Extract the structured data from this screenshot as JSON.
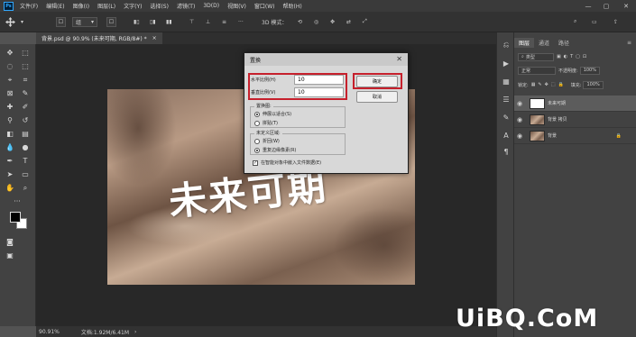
{
  "menu": {
    "logo": "Ps",
    "items": [
      "文件(F)",
      "编辑(E)",
      "图像(I)",
      "图层(L)",
      "文字(Y)",
      "选择(S)",
      "滤镜(T)",
      "3D(D)",
      "视图(V)",
      "窗口(W)",
      "帮助(H)"
    ]
  },
  "options": {
    "tool_preset": "▾",
    "mode": "组",
    "mode_arrow": "▾",
    "more": "···",
    "mode_3d": "3D 模式："
  },
  "document": {
    "tab_label": "背景.psd @ 90.9% (未来可期, RGB/8#) *",
    "tab_close": "×",
    "image_text": "未来可期",
    "zoom": "90.91%",
    "doc_info": "文档:1.92M/6.41M"
  },
  "dialog": {
    "title": "置换",
    "close": "✕",
    "h_scale_label": "水平比例(H)",
    "h_scale_value": "10",
    "v_scale_label": "垂直比例(V)",
    "v_scale_value": "10",
    "ok": "确定",
    "cancel": "取消",
    "displacement_map_title": "置换图:",
    "stretch_to_fit": "伸展以适合(S)",
    "tile": "拼贴(T)",
    "undefined_areas_title": "未定义区域:",
    "wrap_around": "折回(W)",
    "repeat_edge_pixels": "重复边缘像素(R)",
    "embed_smart_object": "在智能对象中嵌入文件数据(E)",
    "embed_checked": true
  },
  "layers_panel": {
    "tabs": [
      "图层",
      "通道",
      "路径"
    ],
    "filter_kind": "类型",
    "blend_mode": "正常",
    "opacity_label": "不透明度:",
    "opacity_value": "100%",
    "lock_label": "锁定:",
    "fill_label": "填充:",
    "fill_value": "100%",
    "layers": [
      {
        "name": "未来可期",
        "selected": true
      },
      {
        "name": "背景 拷贝",
        "selected": false
      },
      {
        "name": "背景",
        "selected": false
      }
    ]
  },
  "watermark": "UiBQ.CoM"
}
